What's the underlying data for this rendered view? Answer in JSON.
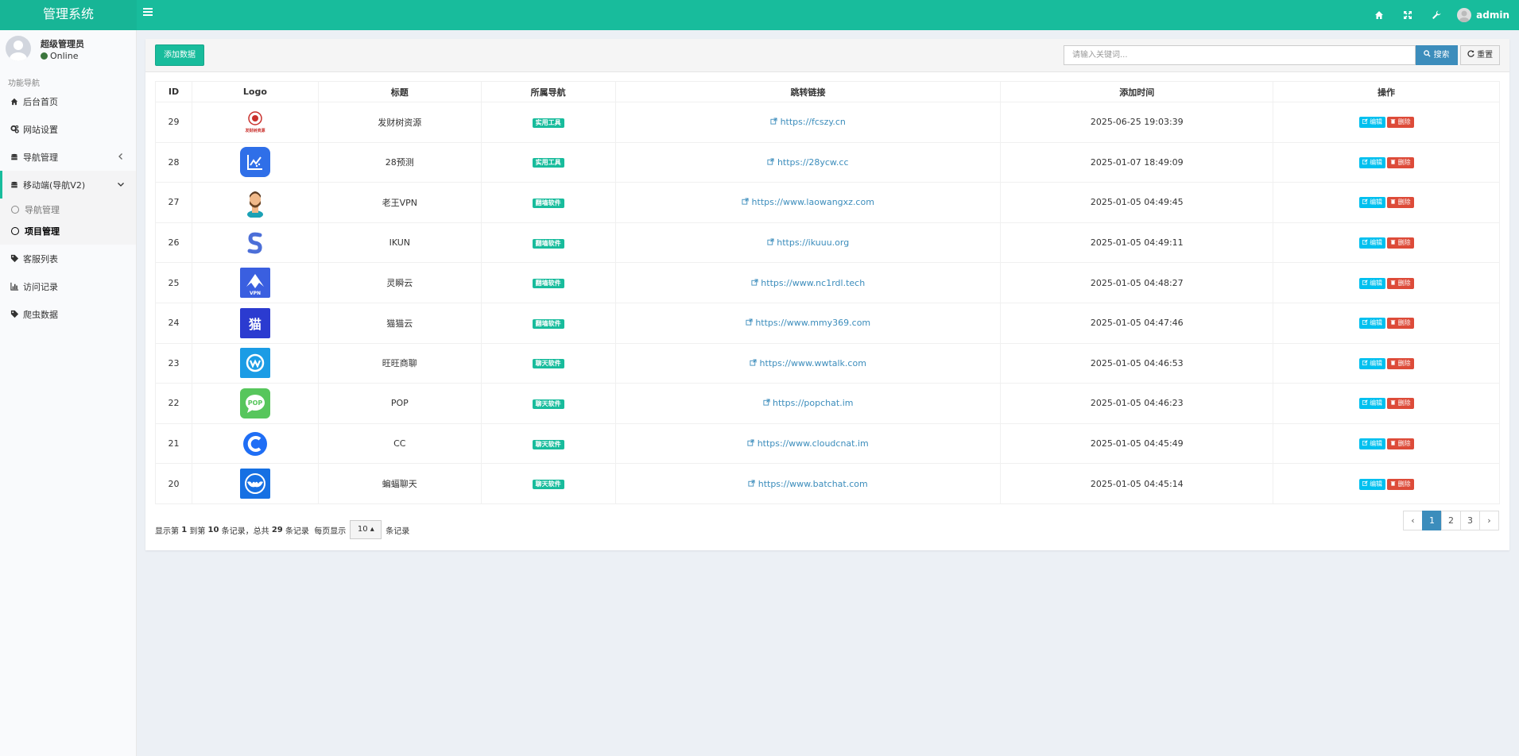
{
  "header": {
    "brand": "管理系统",
    "username": "admin"
  },
  "sidebar": {
    "user_name": "超级管理员",
    "user_status": "Online",
    "section": "功能导航",
    "items": [
      {
        "label": "后台首页"
      },
      {
        "label": "网站设置"
      },
      {
        "label": "导航管理"
      },
      {
        "label": "移动端(导航V2)"
      },
      {
        "label": "客服列表"
      },
      {
        "label": "访问记录"
      },
      {
        "label": "爬虫数据"
      }
    ],
    "subitems": [
      {
        "label": "导航管理"
      },
      {
        "label": "项目管理"
      }
    ]
  },
  "toolbar": {
    "add_label": "添加数据",
    "search_placeholder": "请输入关键词...",
    "search_label": "搜索",
    "reset_label": "重置"
  },
  "table": {
    "headers": [
      "ID",
      "Logo",
      "标题",
      "所属导航",
      "跳转链接",
      "添加时间",
      "操作"
    ],
    "edit_label": "编辑",
    "delete_label": "删除",
    "rows": [
      {
        "id": "29",
        "logo": "fcszy",
        "title": "发财树资源",
        "nav": "实用工具",
        "url": "https://fcszy.cn",
        "time": "2025-06-25 19:03:39"
      },
      {
        "id": "28",
        "logo": "28ycw",
        "title": "28预测",
        "nav": "实用工具",
        "url": "https://28ycw.cc",
        "time": "2025-01-07 18:49:09"
      },
      {
        "id": "27",
        "logo": "laowang",
        "title": "老王VPN",
        "nav": "翻墙软件",
        "url": "https://www.laowangxz.com",
        "time": "2025-01-05 04:49:45"
      },
      {
        "id": "26",
        "logo": "ikun",
        "title": "IKUN",
        "nav": "翻墙软件",
        "url": "https://ikuuu.org",
        "time": "2025-01-05 04:49:11"
      },
      {
        "id": "25",
        "logo": "lingshun",
        "title": "灵瞬云",
        "nav": "翻墙软件",
        "url": "https://www.nc1rdl.tech",
        "time": "2025-01-05 04:48:27"
      },
      {
        "id": "24",
        "logo": "maomao",
        "title": "猫猫云",
        "nav": "翻墙软件",
        "url": "https://www.mmy369.com",
        "time": "2025-01-05 04:47:46"
      },
      {
        "id": "23",
        "logo": "wwtalk",
        "title": "旺旺商聊",
        "nav": "聊天软件",
        "url": "https://www.wwtalk.com",
        "time": "2025-01-05 04:46:53"
      },
      {
        "id": "22",
        "logo": "pop",
        "title": "POP",
        "nav": "聊天软件",
        "url": "https://popchat.im",
        "time": "2025-01-05 04:46:23"
      },
      {
        "id": "21",
        "logo": "cc",
        "title": "CC",
        "nav": "聊天软件",
        "url": "https://www.cloudcnat.im",
        "time": "2025-01-05 04:45:49"
      },
      {
        "id": "20",
        "logo": "batchat",
        "title": "蝙蝠聊天",
        "nav": "聊天软件",
        "url": "https://www.batchat.com",
        "time": "2025-01-05 04:45:14"
      }
    ]
  },
  "footer": {
    "text_a": "显示第",
    "from": "1",
    "text_b": "到第",
    "to": "10",
    "text_c": "条记录，总共",
    "total": "29",
    "text_d": "条记录",
    "text_e": "每页显示",
    "page_size": "10",
    "text_f": "条记录",
    "pages": [
      "‹",
      "1",
      "2",
      "3",
      "›"
    ]
  },
  "logo_text": {
    "maomao": "猫",
    "pop": "POP",
    "vpn": "VPN",
    "fcszy": "发财树资源"
  }
}
